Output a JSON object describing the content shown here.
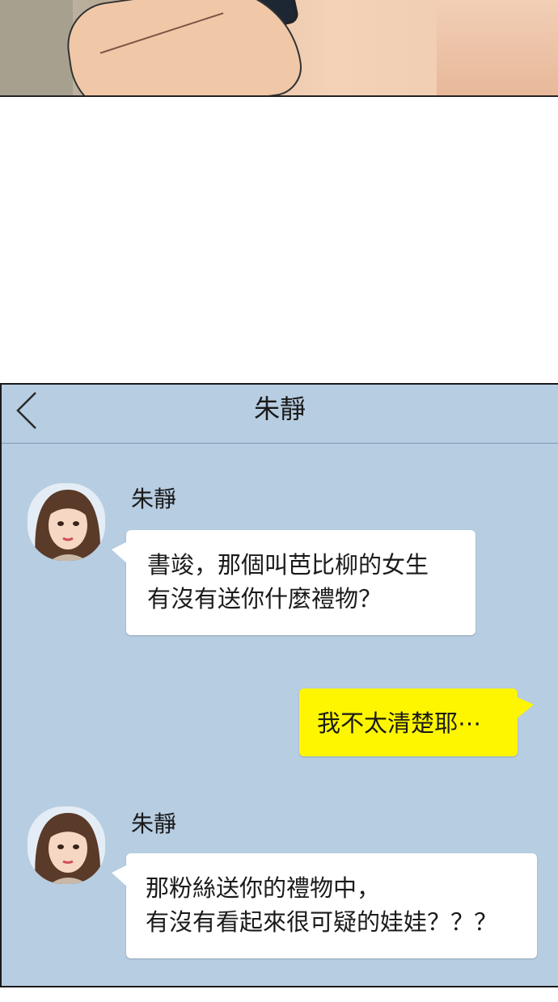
{
  "chat": {
    "header_title": "朱靜",
    "messages": [
      {
        "direction": "incoming",
        "sender": "朱靜",
        "lines": [
          "書竣，那個叫芭比柳的女生",
          "有沒有送你什麼禮物？"
        ]
      },
      {
        "direction": "outgoing",
        "lines": [
          "我不太清楚耶⋯"
        ]
      },
      {
        "direction": "incoming",
        "sender": "朱靜",
        "lines": [
          "那粉絲送你的禮物中，",
          "有沒有看起來很可疑的娃娃？？？"
        ]
      }
    ]
  },
  "colors": {
    "chat_background": "#b7cde2",
    "incoming_bubble": "#ffffff",
    "outgoing_bubble": "#fef600"
  },
  "icons": {
    "back": "chevron-left-icon",
    "avatar": "avatar"
  }
}
